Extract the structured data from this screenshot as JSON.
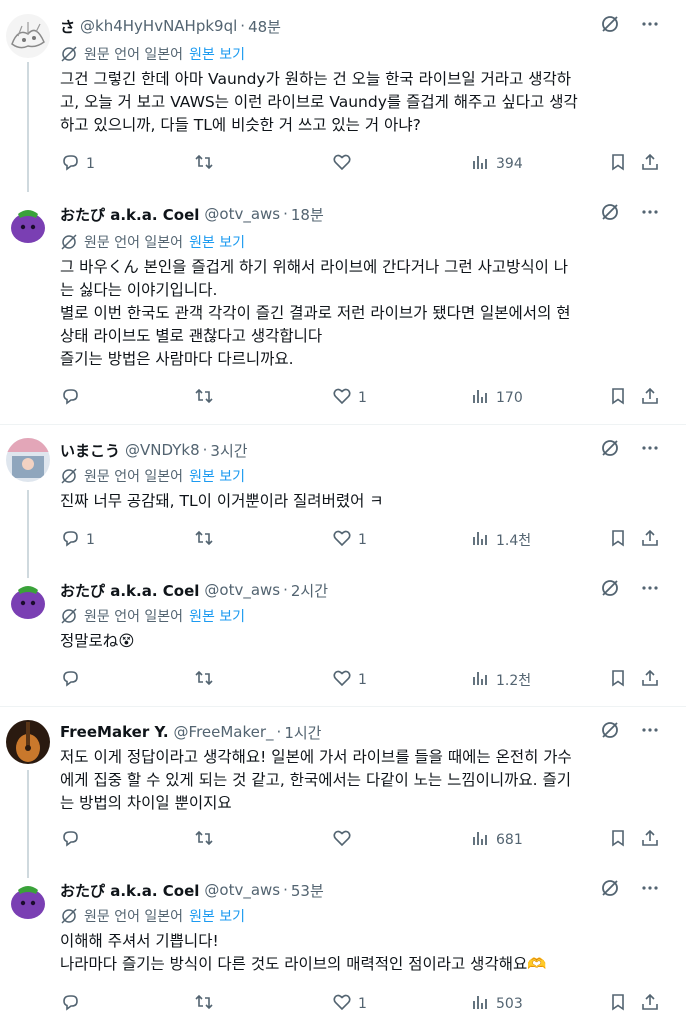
{
  "translate": {
    "label": "원문 언어 일본어",
    "see_original": "원본 보기"
  },
  "tweets": [
    {
      "name": "さ",
      "handle": "@kh4HyHvNAHpk9ql",
      "time": "48분",
      "lines": [
        "그건 그렇긴 한데 아마 Vaundy가 원하는 건 오늘 한국 라이브일 거라고 생각하",
        "고, 오늘 거 보고 VAWS는 이런 라이브로 Vaundy를 즐겁게 해주고 싶다고 생각",
        "하고 있으니까, 다들 TL에 비슷한 거 쓰고 있는 거 아냐?"
      ],
      "replies": "1",
      "retweets": "",
      "likes": "",
      "views": "394"
    },
    {
      "name": "おたぴ a.k.a. Coel",
      "handle": "@otv_aws",
      "time": "18분",
      "lines": [
        "그 바우くん 본인을 즐겁게 하기 위해서 라이브에 간다거나 그런 사고방식이 나",
        "는 싫다는 이야기입니다.",
        "별로 이번 한국도 관객 각각이 즐긴 결과로 저런 라이브가 됐다면 일본에서의 현",
        "상태 라이브도 별로 괜찮다고 생각합니다",
        "즐기는 방법은 사람마다 다르니까요."
      ],
      "replies": "",
      "retweets": "",
      "likes": "1",
      "views": "170"
    },
    {
      "name": "いまこう",
      "handle": "@VNDYk8",
      "time": "3시간",
      "lines": [
        "진짜 너무 공감돼, TL이 이거뿐이라 질려버렸어 ㅋ"
      ],
      "replies": "1",
      "retweets": "",
      "likes": "1",
      "views": "1.4천"
    },
    {
      "name": "おたぴ a.k.a. Coel",
      "handle": "@otv_aws",
      "time": "2시간",
      "lines": [
        "정말로ね😵"
      ],
      "replies": "",
      "retweets": "",
      "likes": "1",
      "views": "1.2천"
    },
    {
      "name": "FreeMaker Y.",
      "handle": "@FreeMaker_",
      "time": "1시간",
      "lines": [
        "저도 이게 정답이라고 생각해요! 일본에 가서 라이브를 들을 때에는 온전히 가수",
        "에게 집중 할 수 있게 되는 것 같고, 한국에서는 다같이 노는 느낌이니까요. 즐기",
        "는 방법의 차이일 뿐이지요"
      ],
      "replies": "",
      "retweets": "",
      "likes": "",
      "views": "681"
    },
    {
      "name": "おたぴ a.k.a. Coel",
      "handle": "@otv_aws",
      "time": "53분",
      "lines": [
        "이해해 주셔서 기쁩니다!",
        "나라마다 즐기는 방식이 다른 것도 라이브의 매력적인 점이라고 생각해요🫶"
      ],
      "replies": "",
      "retweets": "",
      "likes": "1",
      "views": "503"
    }
  ]
}
